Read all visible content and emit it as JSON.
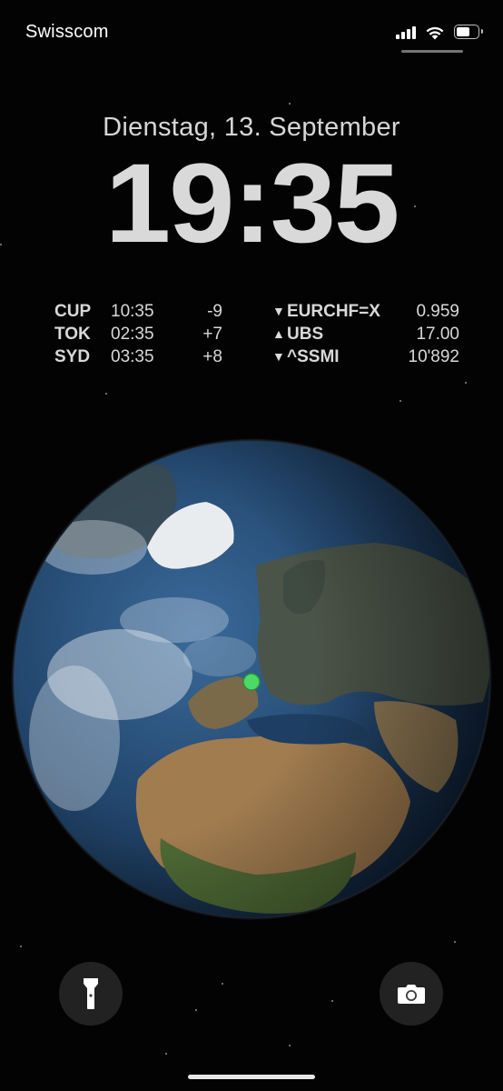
{
  "status_bar": {
    "carrier": "Swisscom",
    "signal_icon": "cellular-signal-icon",
    "wifi_icon": "wifi-icon",
    "battery_icon": "battery-icon",
    "battery_level": 0.55
  },
  "lock_screen": {
    "date": "Dienstag, 13. September",
    "time": "19:35"
  },
  "world_clock": [
    {
      "city": "CUP",
      "time": "10:35",
      "offset": "-9"
    },
    {
      "city": "TOK",
      "time": "02:35",
      "offset": "+7"
    },
    {
      "city": "SYD",
      "time": "03:35",
      "offset": "+8"
    }
  ],
  "stocks": [
    {
      "direction": "down",
      "arrow": "▼",
      "symbol": "EURCHF=X",
      "value": "0.959"
    },
    {
      "direction": "up",
      "arrow": "▲",
      "symbol": "UBS",
      "value": "17.00"
    },
    {
      "direction": "down",
      "arrow": "▼",
      "symbol": "^SSMI",
      "value": "10'892"
    }
  ],
  "wallpaper": {
    "type": "earth-globe",
    "location_marker_color": "#4cd964"
  },
  "quick_actions": {
    "flashlight_icon": "flashlight-icon",
    "camera_icon": "camera-icon"
  }
}
